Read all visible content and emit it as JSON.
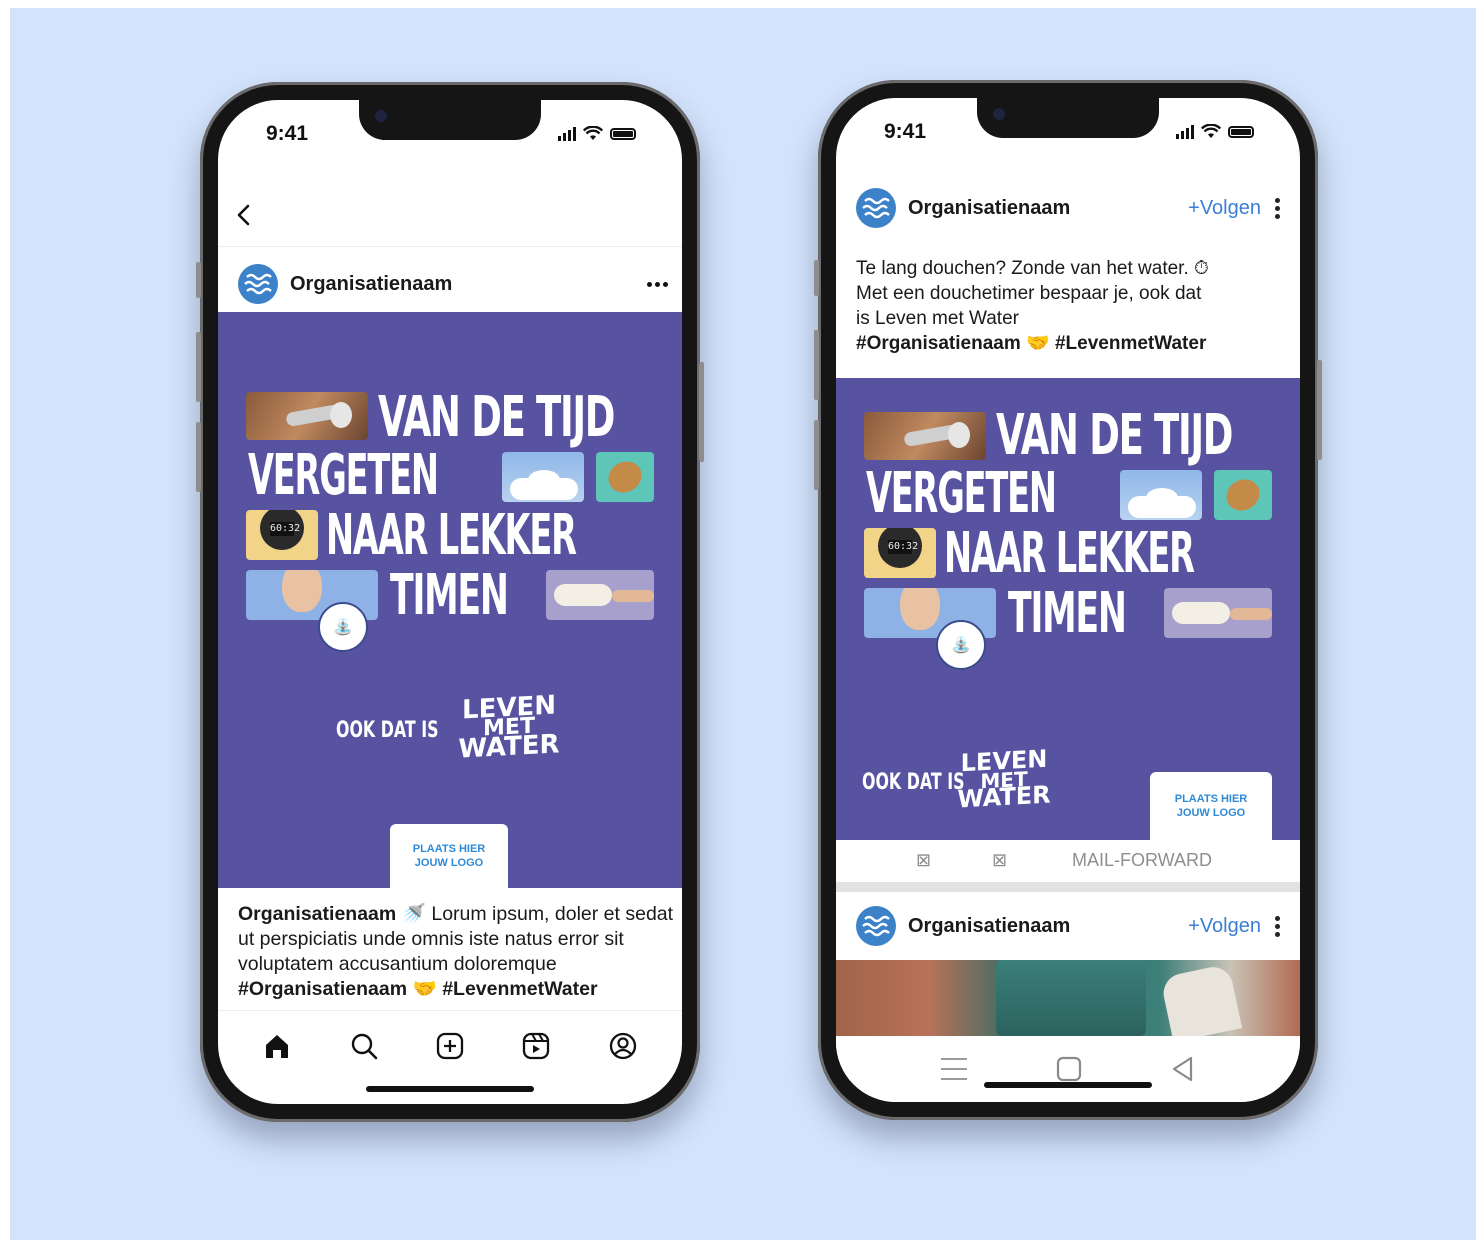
{
  "status": {
    "time": "9:41"
  },
  "post": {
    "org_name": "Organisatienaam",
    "headline": [
      "VAN DE TIJD",
      "VERGETEN",
      "NAAR LEKKER",
      "TIMEN"
    ],
    "ook_dat_is": "OOK DAT IS",
    "brand": [
      "LEVEN",
      "MET",
      "WATER"
    ],
    "logo_placeholder": [
      "PLAATS HIER",
      "JOUW LOGO"
    ],
    "badge_icon": "tap-icon"
  },
  "left_phone": {
    "back_icon": "back-arrow-icon",
    "more_icon": "more-horizontal-icon",
    "caption_user": "Organisatienaam",
    "caption_emoji": "🚿",
    "caption_text": " Lorum ipsum, doler et sedat ut perspiciatis unde omnis iste natus error sit voluptatem accusantium doloremque",
    "caption_tag1": "#Organisatienaam",
    "caption_emoji2": "🤝",
    "caption_tag2": "#LevenmetWater",
    "nav": [
      "home-icon",
      "search-icon",
      "create-icon",
      "reels-icon",
      "profile-icon"
    ]
  },
  "right_phone": {
    "follow_label": "+Volgen",
    "post_text_line1": "Te lang douchen? Zonde van het water. ⏱",
    "post_text_line2": "Met een douchetimer bespaar je, ook dat",
    "post_text_line3": "is Leven met Water",
    "post_tag1": "#Organisatienaam",
    "post_emoji": "🤝",
    "post_tag2": "#LevenmetWater",
    "actions": [
      "⊠",
      "⊠",
      "MAIL-FORWARD"
    ],
    "second_org_name": "Organisatienaam",
    "second_follow_label": "+Volgen",
    "android_nav": [
      "menu-icon",
      "home-square-icon",
      "back-triangle-icon"
    ]
  },
  "colors": {
    "background": "#d3e3fb",
    "poster": "#5753a1",
    "accent_blue": "#3a7fd5"
  }
}
